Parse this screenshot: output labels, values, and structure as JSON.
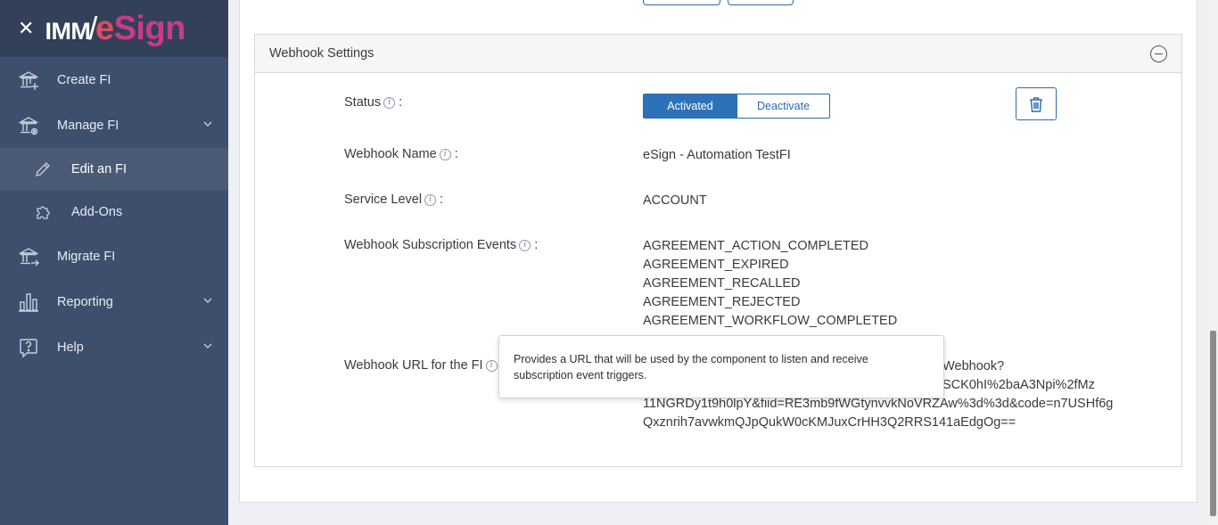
{
  "brand": {
    "close_symbol": "✕",
    "logo_imm": "IMM",
    "logo_slash": "/",
    "logo_e": "e",
    "logo_sign": "Sign"
  },
  "sidebar": {
    "items": [
      {
        "label": "Create FI",
        "icon": "bank-add-icon"
      },
      {
        "label": "Manage FI",
        "icon": "bank-gear-icon",
        "expanded": true
      },
      {
        "label": "Edit an FI",
        "icon": "pencil-icon",
        "active": true
      },
      {
        "label": "Add-Ons",
        "icon": "puzzle-icon"
      },
      {
        "label": "Migrate FI",
        "icon": "bank-arrow-icon"
      },
      {
        "label": "Reporting",
        "icon": "bar-chart-icon"
      },
      {
        "label": "Help",
        "icon": "question-icon"
      }
    ]
  },
  "panel": {
    "title": "Webhook Settings",
    "status_label": "Status",
    "status_options": {
      "active": "Activated",
      "inactive": "Deactivate"
    },
    "name_label": "Webhook Name",
    "name_value": "eSign - Automation TestFI",
    "service_label": "Service Level",
    "service_value": "ACCOUNT",
    "events_label": "Webhook Subscription Events",
    "events": [
      "AGREEMENT_ACTION_COMPLETED",
      "AGREEMENT_EXPIRED",
      "AGREEMENT_RECALLED",
      "AGREEMENT_REJECTED",
      "AGREEMENT_WORKFLOW_COMPLETED"
    ],
    "url_label": "Webhook URL for the FI",
    "url_lines": [
      "gnWebhook?",
      "SCK0hI%2baA3Npi%2fMz",
      "11NGRDy1t9h0lpY&fiid=RE3mb9fWGtynvvkNoVRZAw%3d%3d&code=n7USHf6g",
      "Qxznrih7avwkmQJpQukW0cKMJuxCrHH3Q2RRS141aEdgOg=="
    ],
    "colon": ":",
    "info_glyph": "i"
  },
  "tooltip": {
    "text": "Provides a URL that will be used by the component to listen and receive subscription event triggers."
  },
  "colors": {
    "sidebar": "#3e4f6d",
    "brand_bar": "#324158",
    "accent": "#2d72b8",
    "logo_red": "#e04a64",
    "logo_pink": "#c83b8a"
  }
}
